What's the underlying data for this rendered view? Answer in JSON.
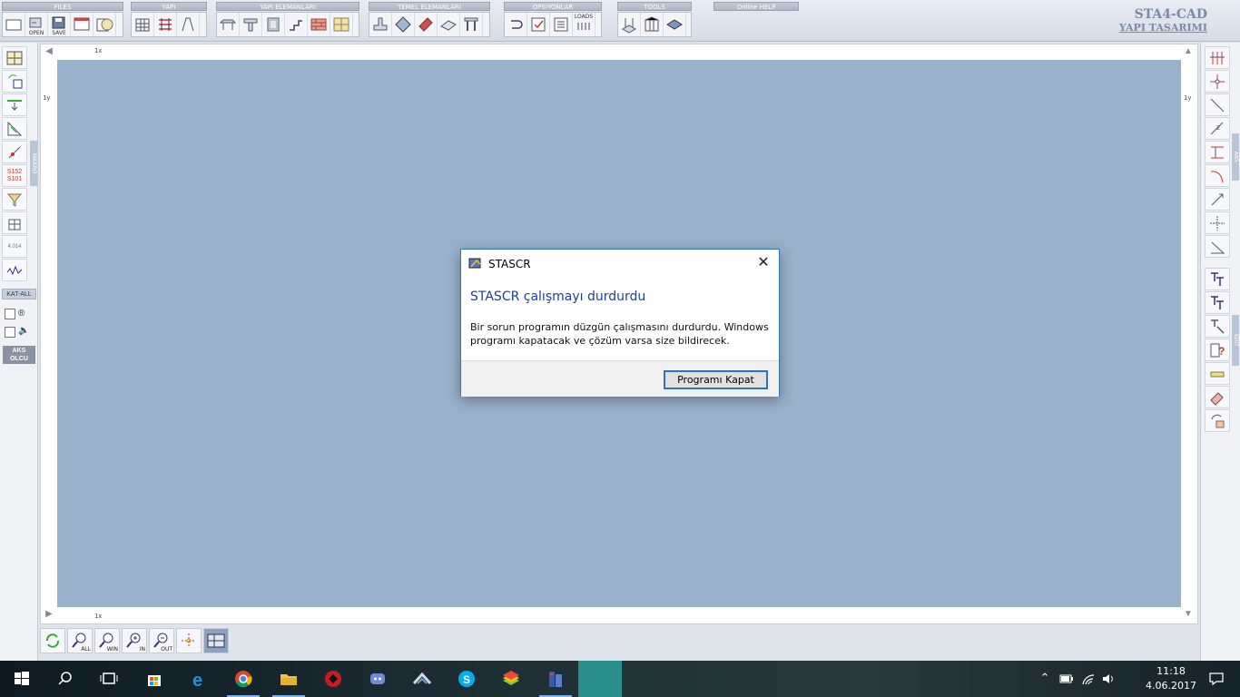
{
  "toolbar": {
    "groups": [
      {
        "title": "FILES"
      },
      {
        "title": "YAPI"
      },
      {
        "title": "YAPI ELEMANLARI"
      },
      {
        "title": "TEMEL ELEMANLARI"
      },
      {
        "title": "OPSIYONLAR"
      },
      {
        "title": "TOOLS"
      },
      {
        "title": "Online HELP"
      }
    ],
    "open_label": "OPEN",
    "save_label": "SAVE",
    "loads_label": "LOADS"
  },
  "brand": {
    "title": "STA4-CAD",
    "subtitle": "YAPI TASARIMI"
  },
  "left_panel": {
    "section_label": "MAKRO",
    "kat_all": "KAT-ALL",
    "aks_olcu_1": "AKS",
    "aks_olcu_2": "OLCU",
    "ctrl_label": "S152",
    "ctrl_label_2": "S101",
    "grid_value": "4.014"
  },
  "right_panel": {
    "section_aks": "AKS",
    "section_edit": "EDIT"
  },
  "canvas": {
    "ruler_x_top": "1x",
    "ruler_y_left": "1y",
    "ruler_y_right": "1y",
    "ruler_x_bottom": "1x",
    "background": "#99b1cb"
  },
  "zoom_bar": {
    "all": "ALL",
    "win": "WIN",
    "in": "IN",
    "out": "OUT"
  },
  "dialog": {
    "title": "STASCR",
    "heading": "STASCR çalışmayı durdurdu",
    "message": "Bir sorun programın düzgün çalışmasını durdurdu. Windows programı kapatacak ve çözüm varsa size bildirecek.",
    "button": "Programı Kapat"
  },
  "taskbar": {
    "time": "11:18",
    "date": "4.06.2017",
    "apps": [
      "start",
      "search",
      "task-view",
      "store",
      "edge",
      "chrome",
      "file-explorer",
      "game-app",
      "discord",
      "vpn-app",
      "skype",
      "bluestacks",
      "sta4cad"
    ]
  }
}
